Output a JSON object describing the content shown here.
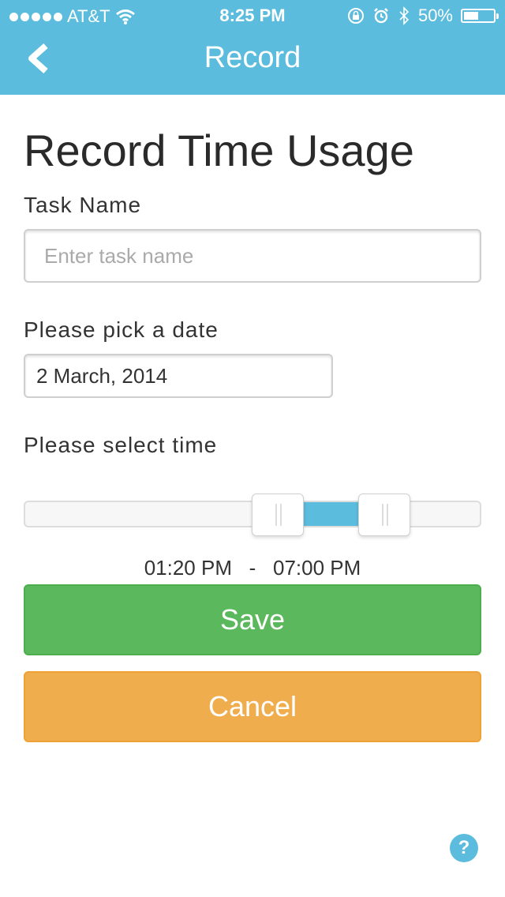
{
  "status_bar": {
    "carrier": "AT&T",
    "time": "8:25 PM",
    "battery_percent": "50%",
    "battery_level": 0.5,
    "signal_dots": 5
  },
  "header": {
    "title": "Record",
    "back_icon": "chevron-left-icon"
  },
  "page_title": "Record Time Usage",
  "form": {
    "task_label": "Task Name",
    "task_placeholder": "Enter task name",
    "task_value": "",
    "date_label": "Please pick a date",
    "date_value": "2 March, 2014",
    "time_label": "Please select time",
    "time_start": "01:20 PM",
    "time_separator": "-",
    "time_end": "07:00 PM",
    "slider_min_fraction": 0.555,
    "slider_max_fraction": 0.79
  },
  "buttons": {
    "save_label": "Save",
    "cancel_label": "Cancel"
  },
  "help": {
    "label": "?",
    "icon": "question-circle-icon"
  },
  "colors": {
    "accent": "#5bbcdd",
    "save": "#5cb85c",
    "cancel": "#f0ad4e"
  }
}
